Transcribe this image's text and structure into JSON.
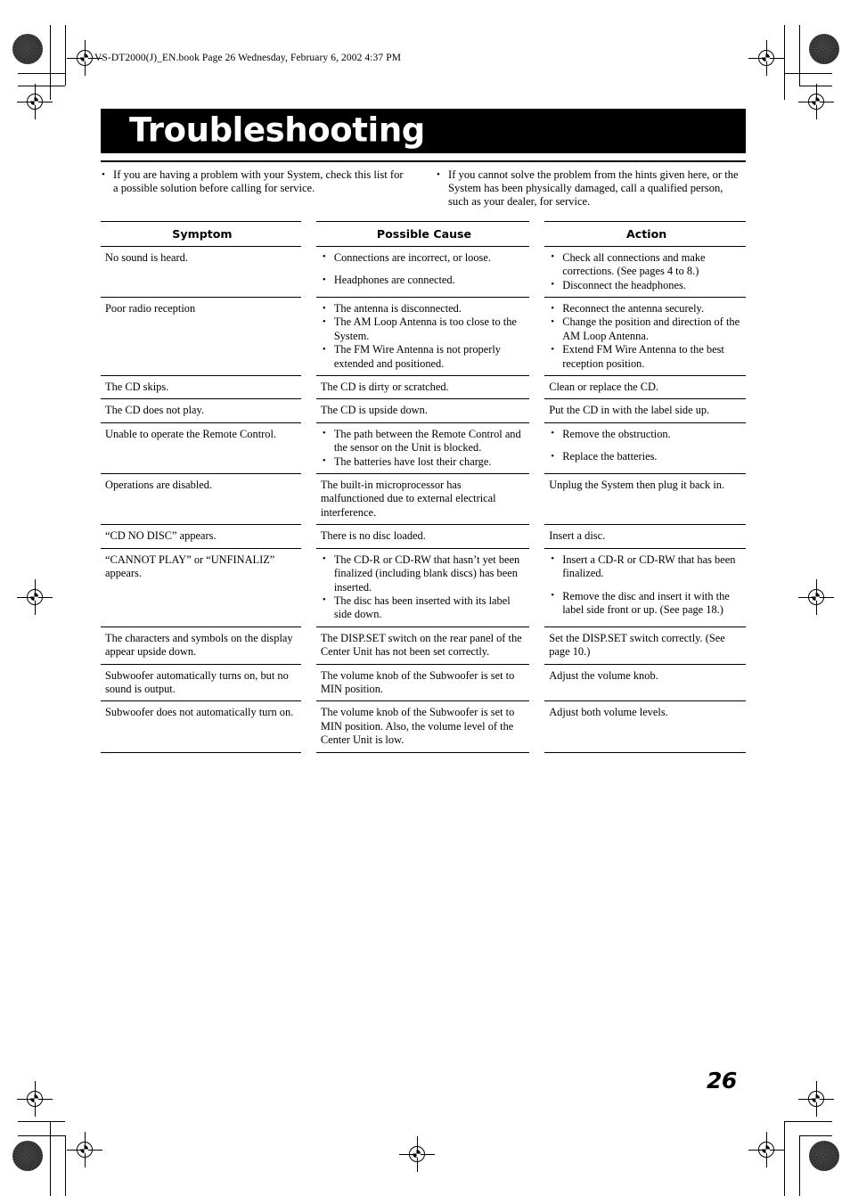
{
  "document": {
    "file_stamp": "VS-DT2000(J)_EN.book  Page 26  Wednesday, February 6, 2002  4:37 PM",
    "title": "Troubleshooting",
    "page_number": "26"
  },
  "intro": {
    "left": "If you are having a problem with your System, check this list for a possible solution before calling for service.",
    "right": "If you cannot solve the problem from the hints given here, or the System has been physically damaged, call a qualified person, such as your dealer, for service."
  },
  "table": {
    "headers": {
      "symptom": "Symptom",
      "cause": "Possible Cause",
      "action": "Action"
    },
    "rows": [
      {
        "symptom": "No sound is heard.",
        "cause_items": [
          "Connections are incorrect, or loose.",
          "Headphones are connected."
        ],
        "action_items": [
          "Check all connections and make corrections. (See pages 4 to 8.)",
          "Disconnect the headphones."
        ]
      },
      {
        "symptom": "Poor radio reception",
        "cause_items": [
          "The antenna is disconnected.",
          "The AM Loop Antenna is too close to the System.",
          "The FM Wire Antenna is not properly extended and positioned."
        ],
        "action_items": [
          "Reconnect the antenna securely.",
          "Change the position and direction of the AM Loop Antenna.",
          "Extend FM Wire Antenna to the best reception position."
        ]
      },
      {
        "symptom": "The CD skips.",
        "cause_text": "The CD is dirty or scratched.",
        "action_text": "Clean or replace the CD."
      },
      {
        "symptom": "The CD does not play.",
        "cause_text": "The CD is upside down.",
        "action_text": "Put the CD in with the label side up."
      },
      {
        "symptom": "Unable to operate the Remote Control.",
        "cause_items": [
          "The path between the Remote Control and the sensor on the Unit is blocked.",
          "The batteries have lost their charge."
        ],
        "action_items": [
          "Remove the obstruction.",
          "Replace the batteries."
        ]
      },
      {
        "symptom": "Operations are disabled.",
        "cause_text": "The built-in microprocessor has malfunctioned due to external electrical interference.",
        "action_text": "Unplug the System then plug it back in."
      },
      {
        "symptom": "“CD NO DISC” appears.",
        "cause_text": "There is no disc loaded.",
        "action_text": "Insert a disc."
      },
      {
        "symptom": "“CANNOT PLAY” or “UNFINALIZ” appears.",
        "cause_items": [
          "The CD-R or CD-RW that hasn’t yet been finalized (including blank discs) has been inserted.",
          "The disc has been inserted with its label side down."
        ],
        "action_items": [
          "Insert a CD-R or CD-RW that has been finalized.",
          "Remove the disc and insert it with the label side front or up. (See page 18.)"
        ]
      },
      {
        "symptom": "The characters and symbols on the display appear upside down.",
        "cause_text": "The DISP.SET switch on the rear panel of the Center Unit has not been set correctly.",
        "action_text": "Set the DISP.SET switch correctly. (See page 10.)"
      },
      {
        "symptom": "Subwoofer automatically turns on, but no sound is output.",
        "cause_text": "The volume knob of the Subwoofer is set to MIN position.",
        "action_text": "Adjust the volume knob."
      },
      {
        "symptom": "Subwoofer does not automatically turn on.",
        "cause_text": "The volume knob of the Subwoofer is set to MIN position. Also, the volume level of the Center Unit is low.",
        "action_text": "Adjust both volume levels."
      }
    ]
  }
}
